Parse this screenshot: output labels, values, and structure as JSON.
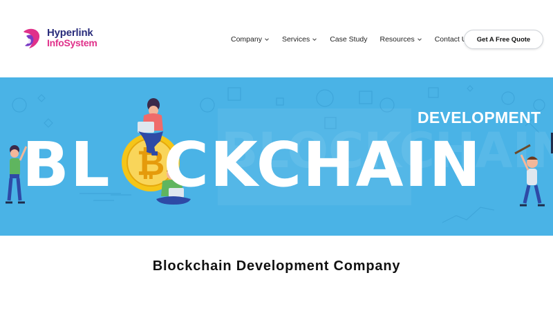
{
  "header": {
    "logo": {
      "line1": "Hyperlink",
      "line2": "InfoSystem"
    },
    "nav": [
      {
        "label": "Company",
        "has_dropdown": true
      },
      {
        "label": "Services",
        "has_dropdown": true
      },
      {
        "label": "Case Study",
        "has_dropdown": false
      },
      {
        "label": "Resources",
        "has_dropdown": true
      },
      {
        "label": "Contact Us",
        "has_dropdown": false
      }
    ],
    "cta_label": "Get A Free Quote"
  },
  "banner": {
    "development_text": "DEVELOPMENT",
    "blockchain_part1": "BL",
    "blockchain_part2": "CKCHAIN",
    "coin_symbol": "₿",
    "colors": {
      "sky": "#4ab3e6",
      "coin": "#f5c518"
    }
  },
  "main": {
    "title": "Blockchain Development Company"
  },
  "colors": {
    "brand_blue": "#2a2d7c",
    "brand_pink": "#e0318a"
  }
}
